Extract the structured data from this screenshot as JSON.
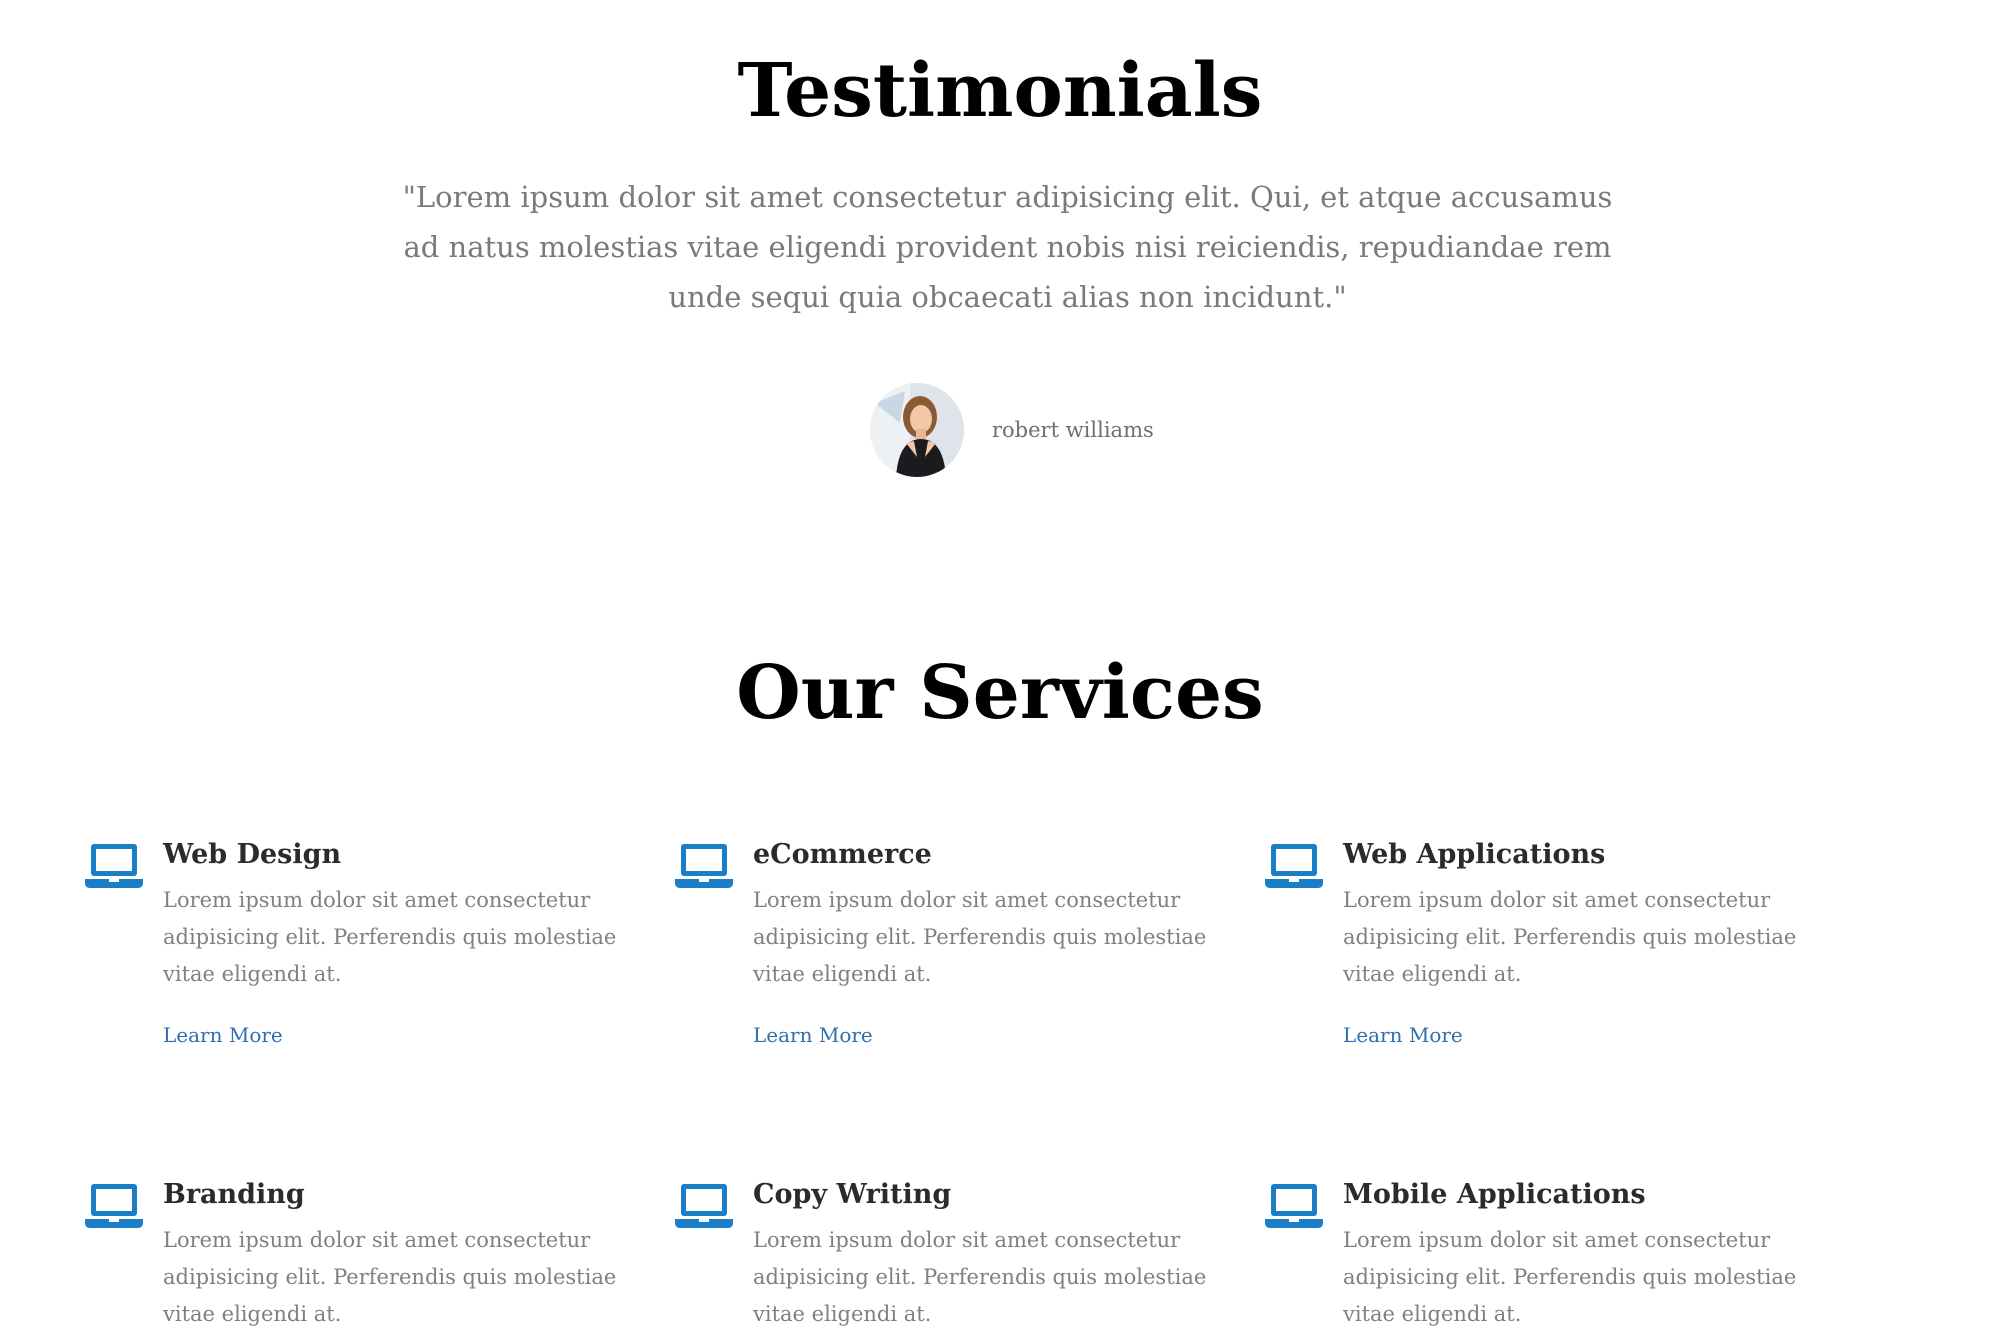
{
  "testimonials": {
    "title": "Testimonials",
    "quote": "\"Lorem ipsum dolor sit amet consectetur adipisicing elit. Qui, et atque accusamus ad natus molestias vitae eligendi provident nobis nisi reiciendis, repudiandae rem unde sequi quia obcaecati alias non incidunt.\"",
    "author_name": "robert williams"
  },
  "services": {
    "title": "Our Services",
    "items": [
      {
        "title": "Web Design",
        "description": "Lorem ipsum dolor sit amet consectetur adipisicing elit. Perferendis quis molestiae vitae eligendi at.",
        "link": "Learn More",
        "icon": "laptop-icon"
      },
      {
        "title": "eCommerce",
        "description": "Lorem ipsum dolor sit amet consectetur adipisicing elit. Perferendis quis molestiae vitae eligendi at.",
        "link": "Learn More",
        "icon": "laptop-icon"
      },
      {
        "title": "Web Applications",
        "description": "Lorem ipsum dolor sit amet consectetur adipisicing elit. Perferendis quis molestiae vitae eligendi at.",
        "link": "Learn More",
        "icon": "laptop-icon"
      },
      {
        "title": "Branding",
        "description": "Lorem ipsum dolor sit amet consectetur adipisicing elit. Perferendis quis molestiae vitae eligendi at.",
        "icon": "laptop-icon"
      },
      {
        "title": "Copy Writing",
        "description": "Lorem ipsum dolor sit amet consectetur adipisicing elit. Perferendis quis molestiae vitae eligendi at.",
        "icon": "laptop-icon"
      },
      {
        "title": "Mobile Applications",
        "description": "Lorem ipsum dolor sit amet consectetur adipisicing elit. Perferendis quis molestiae vitae eligendi at.",
        "icon": "laptop-icon"
      }
    ]
  },
  "colors": {
    "accent": "#1a7dc8",
    "link": "#2f6fb0",
    "muted_text": "#808080",
    "heading": "#000000"
  }
}
